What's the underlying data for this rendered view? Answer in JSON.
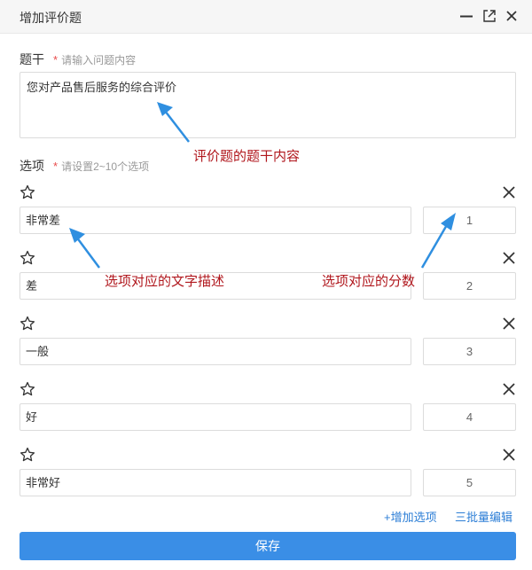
{
  "dialog": {
    "title": "增加评价题",
    "controls": [
      "minimize-icon",
      "maximize-icon",
      "close-icon"
    ]
  },
  "stem": {
    "label": "题干",
    "required_mark": "*",
    "hint": "请输入问题内容",
    "value": "您对产品售后服务的综合评价"
  },
  "options": {
    "label": "选项",
    "required_mark": "*",
    "hint": "请设置2~10个选项",
    "items": [
      {
        "text": "非常差",
        "score": "1"
      },
      {
        "text": "差",
        "score": "2"
      },
      {
        "text": "一般",
        "score": "3"
      },
      {
        "text": "好",
        "score": "4"
      },
      {
        "text": "非常好",
        "score": "5"
      }
    ]
  },
  "actions": {
    "add_option": "+增加选项",
    "batch_edit": "三批量编辑",
    "save": "保存"
  },
  "annotations": {
    "stem_note": "评价题的题干内容",
    "text_note": "选项对应的文字描述",
    "score_note": "选项对应的分数"
  },
  "colors": {
    "primary": "#3a8ee6",
    "link": "#2c7ed6",
    "annotation": "#b0161c",
    "arrow": "#2f8fe0",
    "required": "#e94b4b"
  }
}
